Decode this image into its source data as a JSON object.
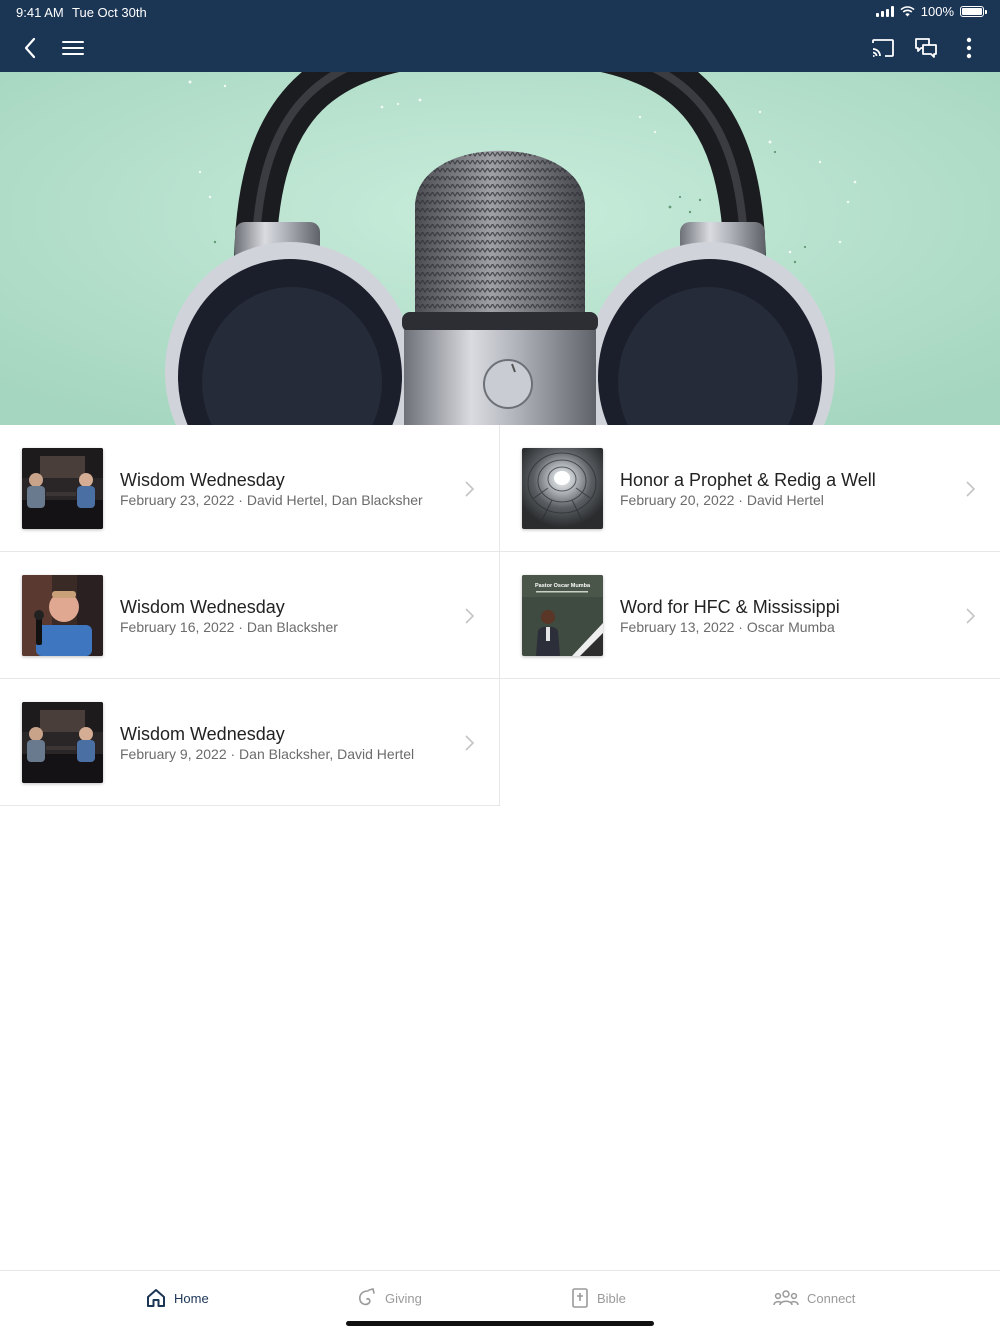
{
  "status_bar": {
    "time": "9:41 AM",
    "date": "Tue Oct 30th",
    "battery": "100%"
  },
  "header": {
    "back_icon": "chevron-left-icon",
    "menu_icon": "hamburger-menu-icon",
    "cast_icon": "cast-icon",
    "chat_icon": "chat-bubbles-icon",
    "more_icon": "more-vertical-icon",
    "background_color": "#1b3555"
  },
  "hero": {
    "image": "podcast microphone between headphones on mint background"
  },
  "items": [
    {
      "title": "Wisdom Wednesday",
      "subtitle": "February 23, 2022 · David Hertel, Dan Blacksher"
    },
    {
      "title": "Honor a Prophet & Redig a Well",
      "subtitle": "February 20, 2022 · David Hertel"
    },
    {
      "title": "Wisdom Wednesday",
      "subtitle": "February 16, 2022 · Dan Blacksher"
    },
    {
      "title": "Word for HFC & Mississippi",
      "subtitle": "February 13, 2022 · Oscar Mumba",
      "thumb_caption": "Pastor Oscar Mumba"
    },
    {
      "title": "Wisdom Wednesday",
      "subtitle": "February 9, 2022 · Dan Blacksher, David Hertel"
    }
  ],
  "tabs": [
    {
      "label": "Home",
      "icon": "home-icon",
      "active": true
    },
    {
      "label": "Giving",
      "icon": "giving-icon",
      "active": false
    },
    {
      "label": "Bible",
      "icon": "bible-icon",
      "active": false
    },
    {
      "label": "Connect",
      "icon": "people-icon",
      "active": false
    }
  ],
  "colors": {
    "accent": "#1b3555",
    "hero_bg": "#b9e2cf",
    "inactive_tab": "#9a9a9a"
  }
}
